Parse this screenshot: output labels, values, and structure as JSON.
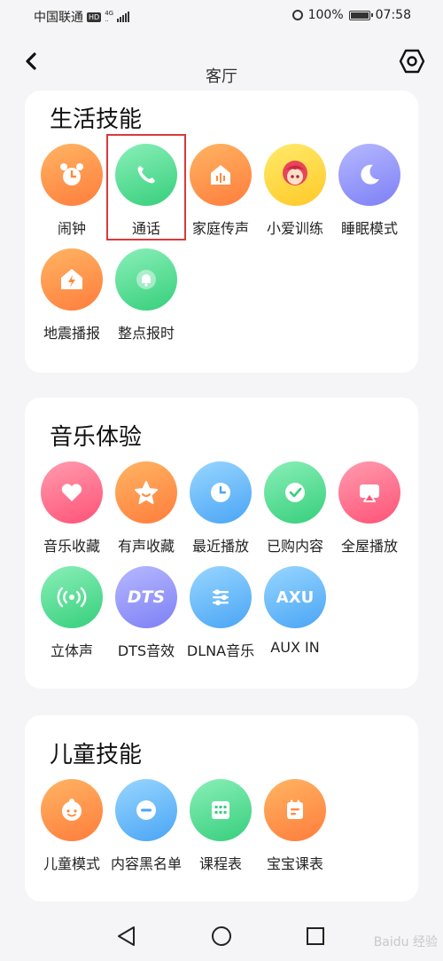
{
  "status_bar": {
    "carrier": "中国联通",
    "hd": "HD",
    "net_top": "4G",
    "net_bottom": "..",
    "battery": "100%",
    "time": "07:58"
  },
  "header": {
    "title": "客厅"
  },
  "sections": [
    {
      "title": "生活技能",
      "skills": [
        {
          "label": "闹钟",
          "icon": "alarm-clock-icon"
        },
        {
          "label": "通话",
          "icon": "phone-icon"
        },
        {
          "label": "家庭传声",
          "icon": "home-voice-icon"
        },
        {
          "label": "小爱训练",
          "icon": "xiaoai-avatar-icon"
        },
        {
          "label": "睡眠模式",
          "icon": "moon-icon"
        },
        {
          "label": "地震播报",
          "icon": "earthquake-icon"
        },
        {
          "label": "整点报时",
          "icon": "bell-icon"
        }
      ]
    },
    {
      "title": "音乐体验",
      "skills": [
        {
          "label": "音乐收藏",
          "icon": "heart-icon"
        },
        {
          "label": "有声收藏",
          "icon": "star-icon"
        },
        {
          "label": "最近播放",
          "icon": "clock-icon"
        },
        {
          "label": "已购内容",
          "icon": "check-icon"
        },
        {
          "label": "全屋播放",
          "icon": "cast-icon"
        },
        {
          "label": "立体声",
          "icon": "stereo-icon"
        },
        {
          "label": "DTS音效",
          "icon": "dts-icon",
          "glyph": "DTS"
        },
        {
          "label": "DLNA音乐",
          "icon": "sliders-icon"
        },
        {
          "label": "AUX IN",
          "icon": "aux-icon",
          "glyph": "AXU"
        }
      ]
    },
    {
      "title": "儿童技能",
      "skills": [
        {
          "label": "儿童模式",
          "icon": "child-face-icon"
        },
        {
          "label": "内容黑名单",
          "icon": "block-icon"
        },
        {
          "label": "课程表",
          "icon": "calendar-grid-icon"
        },
        {
          "label": "宝宝课表",
          "icon": "schedule-icon"
        }
      ]
    }
  ],
  "watermark": "Baidu 经验"
}
